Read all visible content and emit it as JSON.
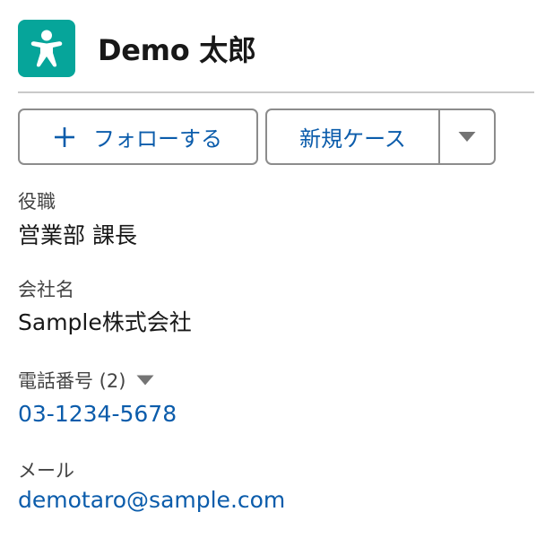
{
  "contact": {
    "name": "Demo 太郎",
    "avatar_icon": "person-standing-icon",
    "avatar_color": "#06a59a"
  },
  "actions": {
    "follow_label": "フォローする",
    "follow_icon": "plus-icon",
    "new_case_label": "新規ケース",
    "more_icon": "chevron-down-icon"
  },
  "fields": {
    "title_label": "役職",
    "title_value": "営業部 課長",
    "company_label": "会社名",
    "company_value": "Sample株式会社",
    "phone_label": "電話番号 (2)",
    "phone_value": "03-1234-5678",
    "email_label": "メール",
    "email_value": "demotaro@sample.com"
  },
  "colors": {
    "link": "#0b5cab",
    "border": "#8c8c8c",
    "label": "#444444"
  }
}
